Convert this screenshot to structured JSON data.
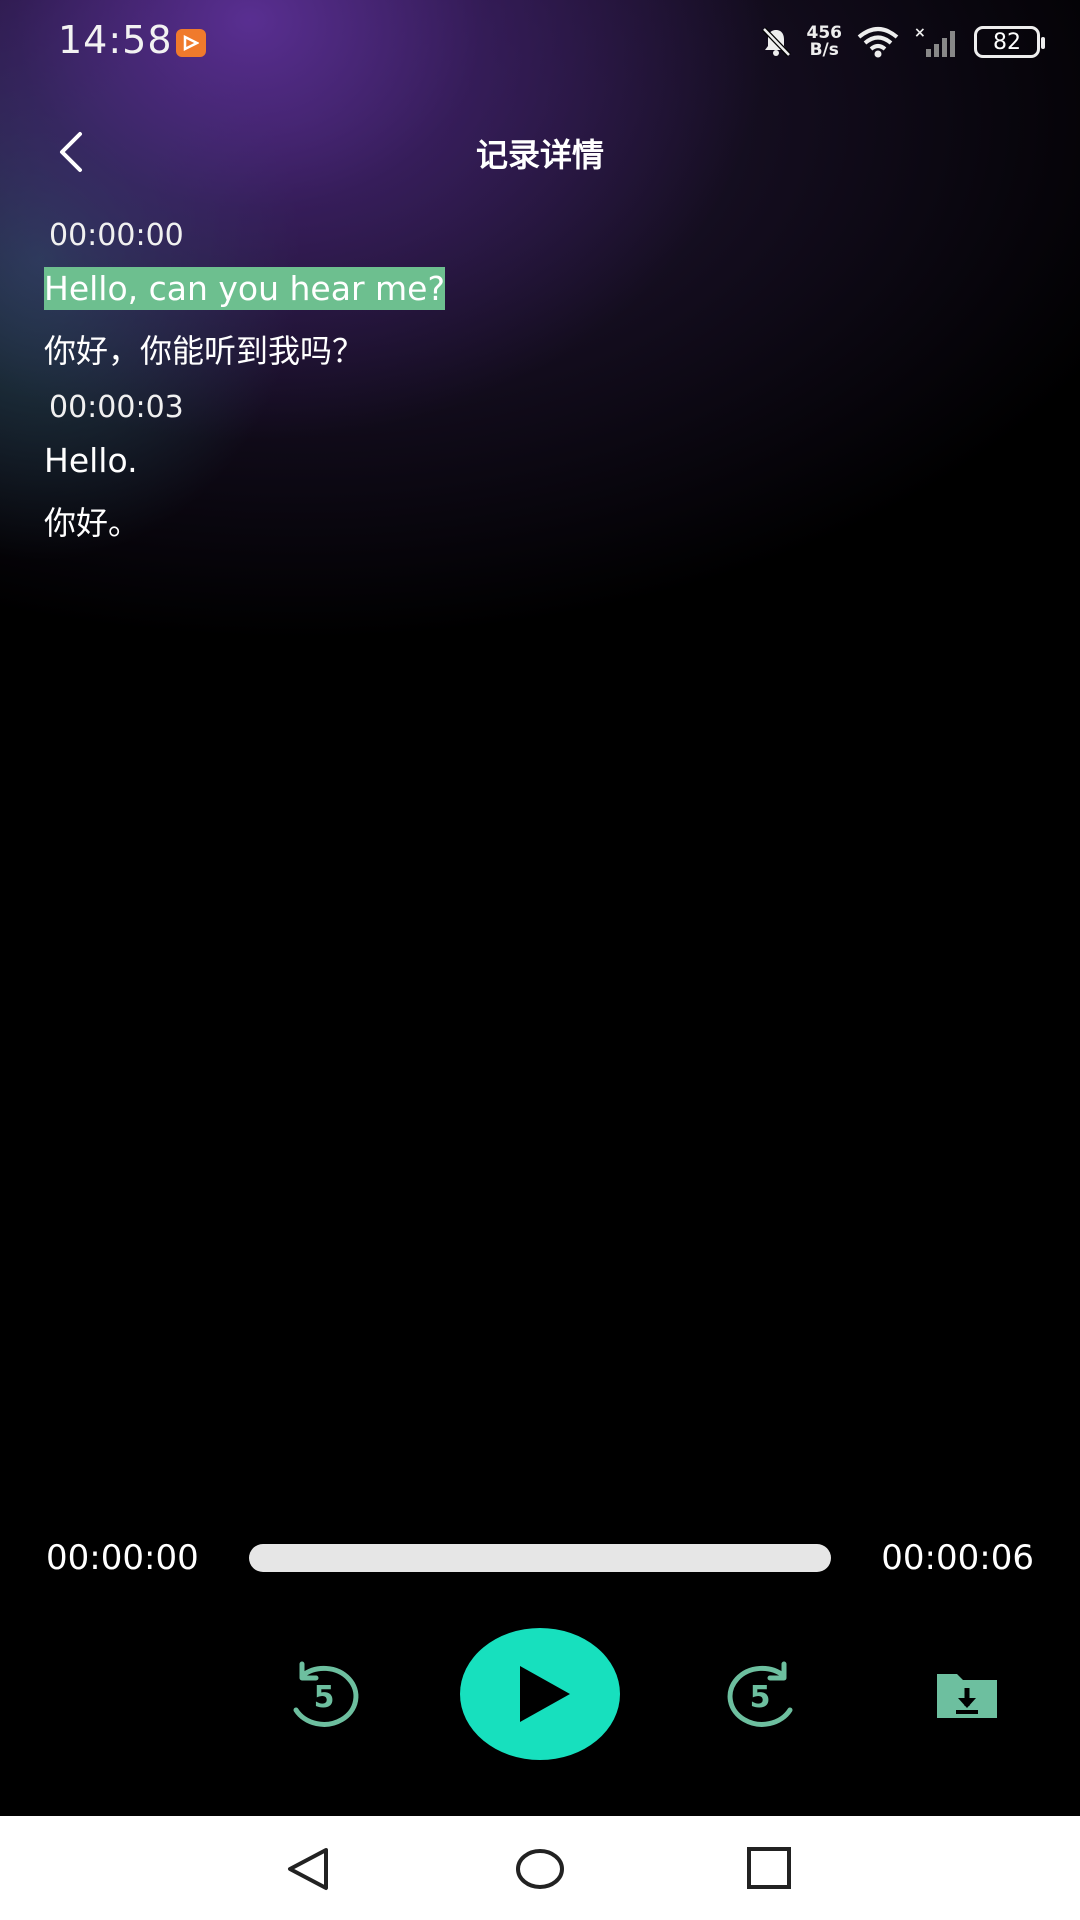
{
  "status_bar": {
    "time": "14:58",
    "app_icon": "play-badge-icon",
    "net_speed_value": "456",
    "net_speed_unit": "B/s",
    "icons": [
      "bell-muted-icon",
      "wifi-icon",
      "signal-icon",
      "battery-icon"
    ],
    "battery": "82"
  },
  "header": {
    "title": "记录详情",
    "back_icon": "chevron-left-icon"
  },
  "transcript": [
    {
      "time": "00:00:00",
      "original": "Hello, can you hear me?",
      "translation": "你好，你能听到我吗？",
      "highlighted": true
    },
    {
      "time": "00:00:03",
      "original": "Hello.",
      "translation": "你好。",
      "highlighted": false
    }
  ],
  "player": {
    "current_time": "00:00:00",
    "total_time": "00:00:06",
    "progress": 0,
    "rewind_seconds": "5",
    "forward_seconds": "5",
    "accent_color": "#17e0be",
    "secondary_color": "#6dbf9f"
  },
  "nav_bar": {
    "icons": [
      "nav-back-icon",
      "nav-home-icon",
      "nav-recents-icon"
    ]
  }
}
